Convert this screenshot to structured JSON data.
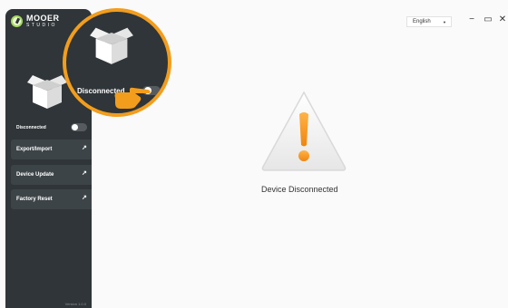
{
  "app": {
    "brand": "MOOER",
    "brand_sub": "STUDIO",
    "version": "Version 1.0.0"
  },
  "sidebar": {
    "connection_label": "Disconnected",
    "menu": [
      {
        "label": "Export/Import"
      },
      {
        "label": "Device Update"
      },
      {
        "label": "Factory Reset"
      }
    ]
  },
  "magnifier": {
    "connection_label": "Disconnected"
  },
  "titlebar": {
    "language": "English",
    "minimize": "−",
    "restore": "▭",
    "close": "✕"
  },
  "main": {
    "status": "Device Disconnected"
  },
  "colors": {
    "sidebar_bg": "#2f3538",
    "accent_orange": "#f39d1c",
    "logo_green": "#a6d860"
  },
  "icons": {
    "logo": "mooer-logo-icon",
    "device": "box-icon",
    "warning": "warning-triangle-icon",
    "pointer": "pointing-hand-icon",
    "menu_arrow": "arrow-up-right-icon"
  }
}
